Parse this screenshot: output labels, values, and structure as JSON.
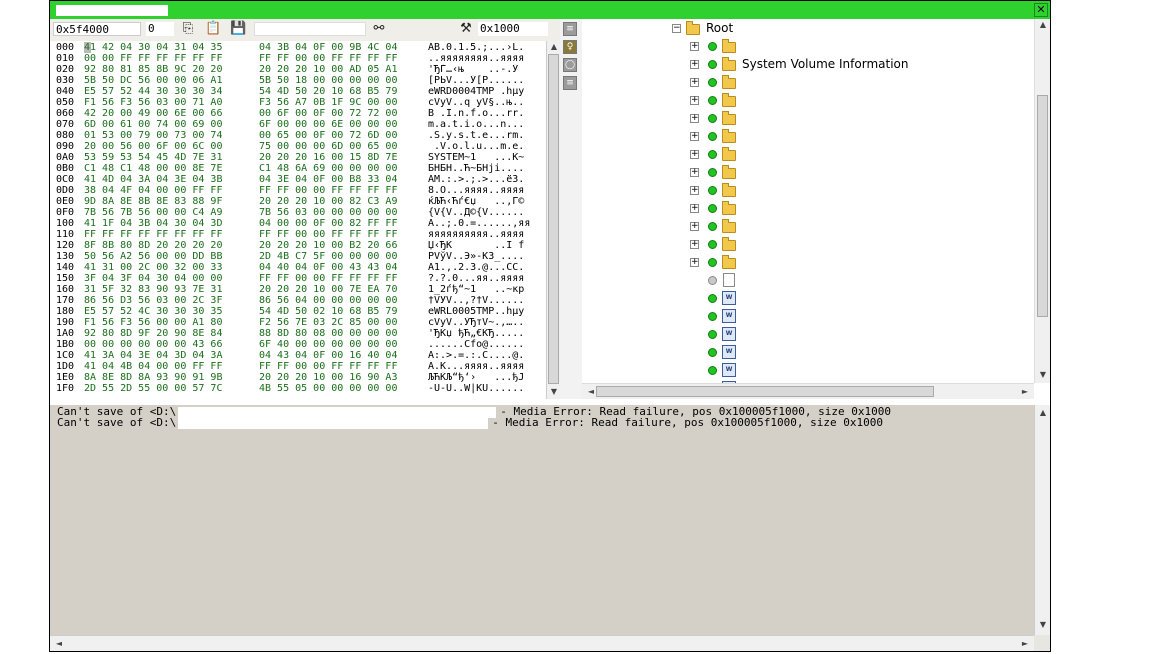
{
  "window": {
    "close_glyph": "✕"
  },
  "toolbar": {
    "offset_value": "0x5f4000",
    "count_value": "0",
    "size_value": "0x1000",
    "icons": [
      "copy-icon",
      "paste-icon",
      "save-icon",
      "binoculars-icon",
      "tools-icon"
    ]
  },
  "hex": {
    "rows": [
      {
        "off": "000",
        "b1": "41 42 04 30 04 31 04 35",
        "b2": "04 3B 04 0F 00 9B 4C 04",
        "asc": "AB.0.1.5.;...›L."
      },
      {
        "off": "010",
        "b1": "00 00 FF FF FF FF FF FF",
        "b2": "FF FF 00 00 FF FF FF FF",
        "asc": "..яяяяяяяя..яяяя"
      },
      {
        "off": "020",
        "b1": "92 80 81 85 8B 9C 20 20",
        "b2": "20 20 20 10 00 AD 05 A1",
        "asc": "'ЂЃ…‹њ    ..-.Ў"
      },
      {
        "off": "030",
        "b1": "5B 50 DC 56 00 00 06 A1",
        "b2": "5B 50 18 00 00 00 00 00",
        "asc": "[PЬV...Ў[P......"
      },
      {
        "off": "040",
        "b1": "E5 57 52 44 30 30 30 34",
        "b2": "54 4D 50 20 10 68 B5 79",
        "asc": "еWRD0004TMP .hµy"
      },
      {
        "off": "050",
        "b1": "F1 56 F3 56 03 00 71 A0",
        "b2": "F3 56 A7 0B 1F 9C 00 00",
        "asc": "сVуV..q уV§..њ.."
      },
      {
        "off": "060",
        "b1": "42 20 00 49 00 6E 00 66",
        "b2": "00 6F 00 0F 00 72 72 00",
        "asc": "B .I.n.f.o...rr."
      },
      {
        "off": "070",
        "b1": "6D 00 61 00 74 00 69 00",
        "b2": "6F 00 00 00 6E 00 00 00",
        "asc": "m.a.t.i.o...n..."
      },
      {
        "off": "080",
        "b1": "01 53 00 79 00 73 00 74",
        "b2": "00 65 00 0F 00 72 6D 00",
        "asc": ".S.y.s.t.e...rm."
      },
      {
        "off": "090",
        "b1": "20 00 56 00 6F 00 6C 00",
        "b2": "75 00 00 00 6D 00 65 00",
        "asc": " .V.o.l.u...m.e."
      },
      {
        "off": "0A0",
        "b1": "53 59 53 54 45 4D 7E 31",
        "b2": "20 20 20 16 00 15 8D 7E",
        "asc": "SYSTEM~1   ...Ќ~"
      },
      {
        "off": "0B0",
        "b1": "C1 48 C1 48 00 00 8E 7E",
        "b2": "C1 48 6A 69 00 00 00 00",
        "asc": "БНБН..Ћ~БНji...."
      },
      {
        "off": "0C0",
        "b1": "41 4D 04 3A 04 3E 04 3B",
        "b2": "04 3E 04 0F 00 B8 33 04",
        "asc": "AM.:.>.;.>...ё3."
      },
      {
        "off": "0D0",
        "b1": "38 04 4F 04 00 00 FF FF",
        "b2": "FF FF 00 00 FF FF FF FF",
        "asc": "8.O...яяяя..яяяя"
      },
      {
        "off": "0E0",
        "b1": "9D 8A 8E 8B 8E 83 88 9F",
        "b2": "20 20 20 10 00 82 C3 A9",
        "asc": "ќЉЋ‹Ћѓ€џ   ..‚Г©"
      },
      {
        "off": "0F0",
        "b1": "7B 56 7B 56 00 00 C4 A9",
        "b2": "7B 56 03 00 00 00 00 00",
        "asc": "{V{V..Д©{V......"
      },
      {
        "off": "100",
        "b1": "41 1F 04 3B 04 30 04 3D",
        "b2": "04 00 00 0F 00 82 FF FF",
        "asc": "A..;.0.=......,яя"
      },
      {
        "off": "110",
        "b1": "FF FF FF FF FF FF FF FF",
        "b2": "FF FF 00 00 FF FF FF FF",
        "asc": "яяяяяяяяяя..яяяя"
      },
      {
        "off": "120",
        "b1": "8F 8B 80 8D 20 20 20 20",
        "b2": "20 20 20 10 00 B2 20 66",
        "asc": "Џ‹ЂЌ       ..I f"
      },
      {
        "off": "130",
        "b1": "50 56 A2 56 00 00 DD BB",
        "b2": "2D 4B C7 5F 00 00 00 00",
        "asc": "PVўV..Э»-KЗ_...."
      },
      {
        "off": "140",
        "b1": "41 31 00 2C 00 32 00 33",
        "b2": "04 40 04 0F 00 43 43 04",
        "asc": "A1.,.2.3.@...CC."
      },
      {
        "off": "150",
        "b1": "3F 04 3F 04 30 04 00 00",
        "b2": "FF FF 00 00 FF FF FF FF",
        "asc": "?.?.0...яя..яяяя"
      },
      {
        "off": "160",
        "b1": "31 5F 32 83 90 93 7E 31",
        "b2": "20 20 20 10 00 7E EA 70",
        "asc": "1_2ѓђ“~1   ..~кp"
      },
      {
        "off": "170",
        "b1": "86 56 D3 56 03 00 2C 3F",
        "b2": "86 56 04 00 00 00 00 00",
        "asc": "†VУV..,?†V......"
      },
      {
        "off": "180",
        "b1": "E5 57 52 4C 30 30 30 35",
        "b2": "54 4D 50 02 10 68 B5 79",
        "asc": "еWRL0005TMP..hµy"
      },
      {
        "off": "190",
        "b1": "F1 56 F3 56 00 00 A1 80",
        "b2": "F2 56 7E 03 2C 85 00 00",
        "asc": "сVуV..ЎЂтV~.,….."
      },
      {
        "off": "1A0",
        "b1": "92 80 8D 9F 20 90 8E 84",
        "b2": "88 8D 80 08 00 00 00 00",
        "asc": "'ЂЌџ ђЋ„€ЌЂ....."
      },
      {
        "off": "1B0",
        "b1": "00 00 00 00 00 00 43 66",
        "b2": "6F 40 00 00 00 00 00 00",
        "asc": "......Cfo@......"
      },
      {
        "off": "1C0",
        "b1": "41 3A 04 3E 04 3D 04 3A",
        "b2": "04 43 04 0F 00 16 40 04",
        "asc": "A:.>.=.:.C....@."
      },
      {
        "off": "1D0",
        "b1": "41 04 4B 04 00 00 FF FF",
        "b2": "FF FF 00 00 FF FF FF FF",
        "asc": "A.K...яяяя..яяяя"
      },
      {
        "off": "1E0",
        "b1": "8A 8E 8D 8A 93 90 91 9B",
        "b2": "20 20 20 10 00 16 90 A3",
        "asc": "ЉЋЌЉ“ђ‘›   ...ђЈ"
      },
      {
        "off": "1F0",
        "b1": "2D 55 2D 55 00 00 57 7C",
        "b2": "4B 55 05 00 00 00 00 00",
        "asc": "-U-U..W|KU......"
      }
    ]
  },
  "tree": {
    "root_label": "Root",
    "items": [
      {
        "label": "",
        "icon": "folder-icon"
      },
      {
        "label": "System Volume Information",
        "icon": "folder-icon"
      },
      {
        "label": "",
        "icon": "folder-icon"
      },
      {
        "label": "",
        "icon": "folder-icon"
      },
      {
        "label": "",
        "icon": "folder-icon"
      },
      {
        "label": "",
        "icon": "folder-icon"
      },
      {
        "label": "",
        "icon": "folder-icon"
      },
      {
        "label": "",
        "icon": "folder-icon"
      },
      {
        "label": "",
        "icon": "folder-icon"
      },
      {
        "label": "",
        "icon": "folder-icon"
      },
      {
        "label": "",
        "icon": "folder-icon"
      },
      {
        "label": "",
        "icon": "folder-icon"
      },
      {
        "label": "",
        "icon": "folder-icon"
      },
      {
        "label": "",
        "icon": "file-icon"
      },
      {
        "label": "",
        "icon": "word-doc-icon"
      },
      {
        "label": "",
        "icon": "word-doc-icon"
      },
      {
        "label": "",
        "icon": "word-doc-icon"
      },
      {
        "label": "",
        "icon": "word-doc-icon"
      },
      {
        "label": "",
        "icon": "word-doc-icon"
      },
      {
        "label": "",
        "icon": "word-doc-icon"
      }
    ],
    "doc_glyph": "W",
    "expand_glyph": "+",
    "collapse_glyph": "−"
  },
  "log": {
    "lines": [
      {
        "prefix": "Can't save of <D:\\",
        "suffix": "- Media Error: Read failure, pos 0x100005f1000, size 0x1000"
      },
      {
        "prefix": "Can't save of <D:\\",
        "suffix": "- Media Error: Read failure, pos 0x100005f1000, size 0x1000"
      }
    ]
  }
}
